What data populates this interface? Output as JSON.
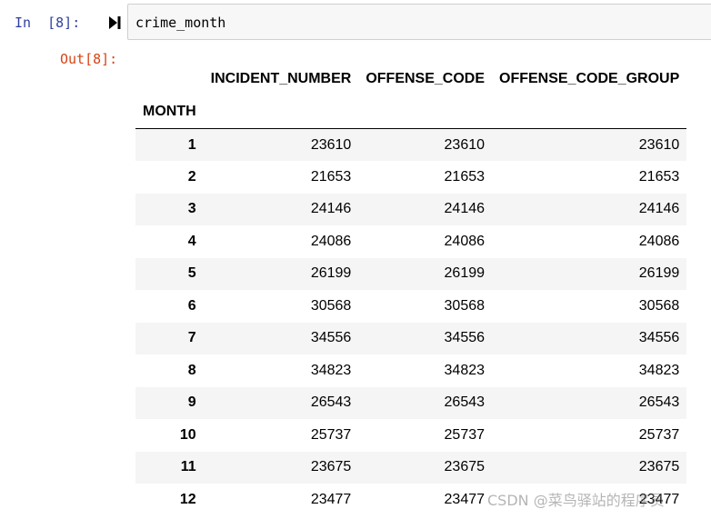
{
  "input_cell": {
    "prompt": "In  [8]:",
    "code": "crime_month"
  },
  "output_cell": {
    "prompt": "Out[8]:"
  },
  "table": {
    "columns": [
      "INCIDENT_NUMBER",
      "OFFENSE_CODE",
      "OFFENSE_CODE_GROUP"
    ],
    "index_name": "MONTH",
    "rows": [
      {
        "index": "1",
        "values": [
          "23610",
          "23610",
          "23610"
        ]
      },
      {
        "index": "2",
        "values": [
          "21653",
          "21653",
          "21653"
        ]
      },
      {
        "index": "3",
        "values": [
          "24146",
          "24146",
          "24146"
        ]
      },
      {
        "index": "4",
        "values": [
          "24086",
          "24086",
          "24086"
        ]
      },
      {
        "index": "5",
        "values": [
          "26199",
          "26199",
          "26199"
        ]
      },
      {
        "index": "6",
        "values": [
          "30568",
          "30568",
          "30568"
        ]
      },
      {
        "index": "7",
        "values": [
          "34556",
          "34556",
          "34556"
        ]
      },
      {
        "index": "8",
        "values": [
          "34823",
          "34823",
          "34823"
        ]
      },
      {
        "index": "9",
        "values": [
          "26543",
          "26543",
          "26543"
        ]
      },
      {
        "index": "10",
        "values": [
          "25737",
          "25737",
          "25737"
        ]
      },
      {
        "index": "11",
        "values": [
          "23675",
          "23675",
          "23675"
        ]
      },
      {
        "index": "12",
        "values": [
          "23477",
          "23477",
          "23477"
        ]
      }
    ]
  },
  "watermark": "CSDN @菜鸟驿站的程序员",
  "colors": {
    "in_prompt": "#303f9f",
    "out_prompt": "#d84315",
    "input_bg": "#f7f7f7",
    "stripe": "#f5f5f5"
  },
  "icons": {
    "run": "run-cell-icon"
  }
}
